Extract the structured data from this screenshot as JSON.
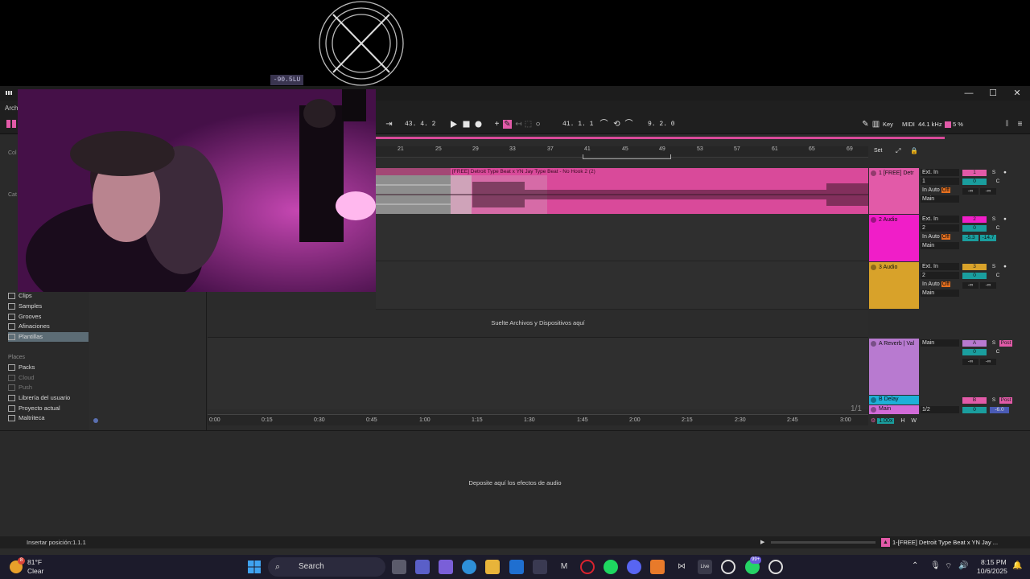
{
  "overlay": {
    "lufs": "-90.5LU"
  },
  "window": {
    "menu_first": "Arch",
    "controls": {
      "minimize": "—",
      "maximize": "☐",
      "close": "✕"
    }
  },
  "transport": {
    "position_left": "43.  4.  2",
    "arrangement_position": "41.  1.  1",
    "loop_length": "9.  2.  0",
    "key_label": "Key",
    "midi_label": "MIDI",
    "sample_rate": "44.1 kHz",
    "cpu": "5 %"
  },
  "browser": {
    "cat_fragments": [
      "Col",
      "Cat"
    ],
    "items": [
      {
        "label": "Clips",
        "selected": false
      },
      {
        "label": "Samples",
        "selected": false
      },
      {
        "label": "Grooves",
        "selected": false
      },
      {
        "label": "Afinaciones",
        "selected": false
      },
      {
        "label": "Plantillas",
        "selected": true
      }
    ],
    "places_heading": "Places",
    "places": [
      {
        "label": "Packs",
        "dim": false
      },
      {
        "label": "Cloud",
        "dim": true
      },
      {
        "label": "Push",
        "dim": true
      },
      {
        "label": "Librería del usuario",
        "dim": false
      },
      {
        "label": "Proyecto actual",
        "dim": false
      },
      {
        "label": "Maltriteca",
        "dim": false
      }
    ]
  },
  "ruler": {
    "bars": [
      "21",
      "25",
      "29",
      "33",
      "37",
      "41",
      "45",
      "49",
      "53",
      "57",
      "61",
      "65",
      "69"
    ],
    "set_label": "Set"
  },
  "clip": {
    "title": "[FREE] Detroit Type Beat x YN Jay Type Beat - No Hook 2 (2)"
  },
  "arrangement": {
    "drop_text": "Suelte Archivos y Dispositivos aquí",
    "page_indicator": "1/1",
    "time_ticks": [
      "0:00",
      "0:15",
      "0:30",
      "0:45",
      "1:00",
      "1:15",
      "1:30",
      "1:45",
      "2:00",
      "2:15",
      "2:30",
      "2:45",
      "3:00"
    ]
  },
  "tracks": [
    {
      "name": "1 [FREE] Detr",
      "color": "#e25aa8",
      "input": "Ext. In",
      "channel": "1",
      "monitor": [
        "In",
        "Auto",
        "Off"
      ],
      "output": "Main",
      "num": "1",
      "vol": "0",
      "pan": "C",
      "meter_l": "-∞",
      "meter_r": "-∞"
    },
    {
      "name": "2 Audio",
      "color": "#f01ec8",
      "input": "Ext. In",
      "channel": "2",
      "monitor": [
        "In",
        "Auto",
        "Off"
      ],
      "output": "Main",
      "num": "2",
      "vol": "0",
      "pan": "C",
      "meter_l": "-5.3",
      "meter_r": "-14.7"
    },
    {
      "name": "3 Audio",
      "color": "#d8a22a",
      "input": "Ext. In",
      "channel": "2",
      "monitor": [
        "In",
        "Auto",
        "Off"
      ],
      "output": "Main",
      "num": "3",
      "vol": "0",
      "pan": "C",
      "meter_l": "-∞",
      "meter_r": "-∞"
    }
  ],
  "returns": [
    {
      "name": "A Reverb | Val",
      "color": "#b87ad0",
      "output": "Main",
      "num": "A",
      "vol": "0",
      "pan": "C",
      "meter_l": "-∞",
      "meter_r": "-∞",
      "post": "Post"
    },
    {
      "name": "B Delay",
      "color": "#1fb0d8",
      "num": "B",
      "post": "Post"
    }
  ],
  "master": {
    "name": "Main",
    "color": "#d26bd8",
    "output": "1/2",
    "vol": "0",
    "level": "-6.0",
    "zoom": "1.00x",
    "h": "H",
    "w": "W"
  },
  "solo_label": "S",
  "devices": {
    "drop_text": "Deposite aquí los efectos de audio"
  },
  "status": {
    "left": "Insertar posición:1.1.1",
    "track": "1-[FREE] Detroit Type Beat x YN Jay ..."
  },
  "taskbar": {
    "weather_temp": "81°F",
    "weather_cond": "Clear",
    "weather_badge": "8",
    "search": "Search",
    "clock_time": "8:15 PM",
    "clock_date": "10/6/2025",
    "whatsapp_badge": "99+"
  }
}
